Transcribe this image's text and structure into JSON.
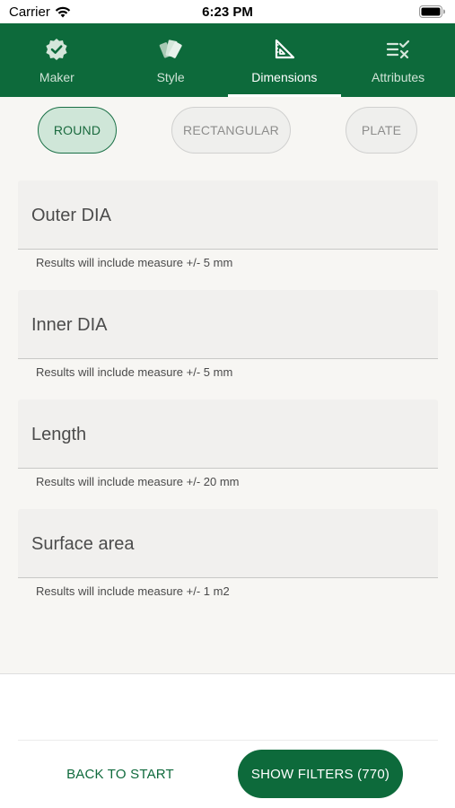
{
  "status": {
    "carrier": "Carrier",
    "time": "6:23 PM"
  },
  "tabs": [
    {
      "label": "Maker",
      "icon": "verified-badge-icon"
    },
    {
      "label": "Style",
      "icon": "swatches-icon"
    },
    {
      "label": "Dimensions",
      "icon": "set-square-icon",
      "active": true
    },
    {
      "label": "Attributes",
      "icon": "filter-list-icon"
    }
  ],
  "shapes": {
    "round": "ROUND",
    "rectangular": "RECTANGULAR",
    "plate": "PLATE",
    "selected": "ROUND"
  },
  "fields": [
    {
      "label": "Outer DIA",
      "hint": "Results will include measure +/- 5 mm"
    },
    {
      "label": "Inner DIA",
      "hint": "Results will include measure +/- 5 mm"
    },
    {
      "label": "Length",
      "hint": "Results will include measure +/- 20 mm"
    },
    {
      "label": "Surface area",
      "hint": "Results will include measure +/- 1 m2"
    }
  ],
  "footer": {
    "back_label": "BACK TO START",
    "show_label": "SHOW FILTERS (770)"
  },
  "colors": {
    "brand": "#0d6a3b",
    "selected_fill": "#cfe6d8"
  }
}
